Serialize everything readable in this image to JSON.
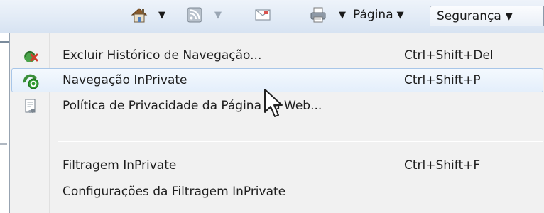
{
  "toolbar": {
    "home_icon": "home-icon",
    "feeds_icon": "feeds-icon",
    "mail_icon": "read-mail-icon",
    "print_icon": "print-icon",
    "dropdown_arrow": "▼",
    "pagina_label": "Página",
    "seguranca_label": "Segurança"
  },
  "menu": {
    "items": [
      {
        "label": "Excluir Histórico de Navegação...",
        "shortcut": "Ctrl+Shift+Del",
        "icon": "delete-history-icon"
      },
      {
        "label": "Navegação InPrivate",
        "shortcut": "Ctrl+Shift+P",
        "icon": "inprivate-icon",
        "highlighted": true
      },
      {
        "label": "Política de Privacidade da Página da Web...",
        "shortcut": "",
        "icon": "privacy-policy-icon"
      },
      {
        "label": "Filtragem InPrivate",
        "shortcut": "Ctrl+Shift+F"
      },
      {
        "label": "Configurações da Filtragem InPrivate",
        "shortcut": ""
      }
    ]
  }
}
